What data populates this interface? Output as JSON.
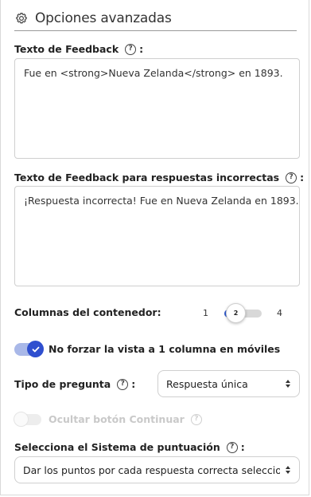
{
  "header": {
    "title": "Opciones avanzadas",
    "icon": "gear-icon"
  },
  "feedback": {
    "label": "Texto de Feedback",
    "colon": ":",
    "help": "?",
    "value": "Fue en <strong>Nueva Zelanda</strong> en 1893."
  },
  "feedback_incorrect": {
    "label": "Texto de Feedback para respuestas incorrectas",
    "colon": ":",
    "help": "?",
    "value": "¡Respuesta incorrecta! Fue en Nueva Zelanda en 1893."
  },
  "columns": {
    "label": "Columnas del contenedor:",
    "min": "1",
    "max": "4",
    "current": "2"
  },
  "mobile_toggle": {
    "label": "No forzar la vista a 1 columna en móviles",
    "checked": true,
    "accent": "#2f4fcf"
  },
  "question_type": {
    "label": "Tipo de pregunta",
    "colon": ":",
    "help": "?",
    "selected": "Respuesta única"
  },
  "hide_continue": {
    "label": "Ocultar botón Continuar",
    "help": "?",
    "checked": false,
    "disabled": true
  },
  "scoring": {
    "label": "Selecciona el Sistema de puntuación",
    "colon": ":",
    "help": "?",
    "selected": "Dar los puntos por cada respuesta correcta seleccion"
  }
}
